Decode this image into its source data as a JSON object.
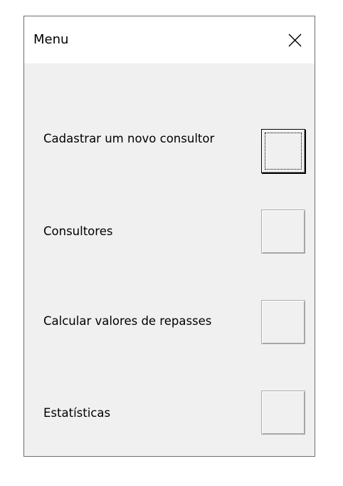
{
  "window": {
    "title": "Menu"
  },
  "buttons": [
    {
      "label": "Cadastrar um novo consultor",
      "focused": true
    },
    {
      "label": "Consultores",
      "focused": false
    },
    {
      "label": "Calcular valores de repasses",
      "focused": false
    },
    {
      "label": "Estatísticas",
      "focused": false
    }
  ],
  "icons": {
    "close": "close-icon"
  },
  "colors": {
    "window_bg": "#f0f0f0",
    "titlebar_bg": "#ffffff",
    "border": "#6f6f6f"
  }
}
